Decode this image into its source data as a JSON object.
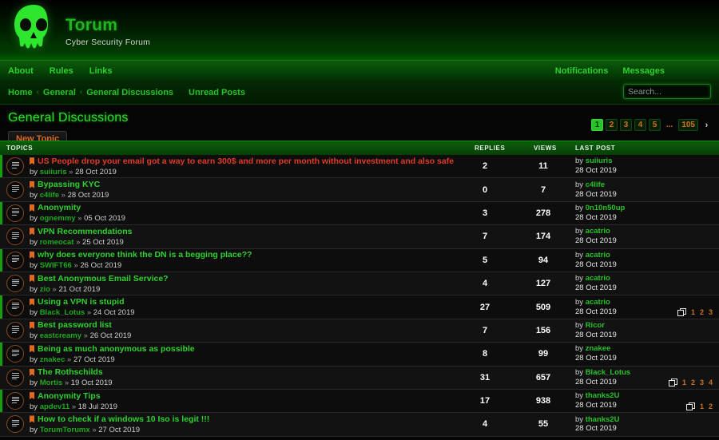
{
  "header": {
    "brand_title": "Torum",
    "brand_subtitle": "Cyber Security Forum",
    "logo_icon": "skull-icon"
  },
  "nav": {
    "left_links": [
      {
        "label": "About"
      },
      {
        "label": "Rules"
      },
      {
        "label": "Links"
      }
    ],
    "right_links": [
      {
        "label": "Notifications"
      },
      {
        "label": "Messages"
      }
    ]
  },
  "breadcrumb": {
    "items": [
      {
        "label": "Home"
      },
      {
        "label": "General"
      },
      {
        "label": "General Discussions"
      }
    ],
    "separator": "‹",
    "extra_link": "Unread Posts"
  },
  "search": {
    "placeholder": "Search...",
    "value": "",
    "icon": "search-icon"
  },
  "page": {
    "title": "General Discussions",
    "new_topic_label": "New Topic"
  },
  "pagination": {
    "pages": [
      "1",
      "2",
      "3",
      "4",
      "5",
      "...",
      "105"
    ],
    "active": "1",
    "next_label": "›"
  },
  "table": {
    "columns": {
      "topics": "TOPICS",
      "replies": "REPLIES",
      "views": "VIEWS",
      "lastpost": "LAST POST"
    },
    "by_label": "by",
    "meta_separator": "»"
  },
  "topics": [
    {
      "title": "US People drop your email got a way to earn 300$ and more per month without investment and also safe",
      "title_color": "red",
      "author": "suiiuris",
      "date": "28 Oct 2019",
      "replies": "2",
      "views": "11",
      "last_user": "suiiuris",
      "last_date": "28 Oct 2019",
      "subpages": []
    },
    {
      "title": "Bypassing KYC",
      "title_color": "green",
      "author": "c4life",
      "date": "28 Oct 2019",
      "replies": "0",
      "views": "7",
      "last_user": "c4life",
      "last_date": "28 Oct 2019",
      "subpages": []
    },
    {
      "title": "Anonymity",
      "title_color": "green",
      "author": "ognemmy",
      "date": "05 Oct 2019",
      "replies": "3",
      "views": "278",
      "last_user": "0n10n50up",
      "last_date": "28 Oct 2019",
      "subpages": []
    },
    {
      "title": "VPN Recommendations",
      "title_color": "green",
      "author": "romeocat",
      "date": "25 Oct 2019",
      "replies": "7",
      "views": "174",
      "last_user": "acatrio",
      "last_date": "28 Oct 2019",
      "subpages": []
    },
    {
      "title": "why does everyone think the DN is a begging place??",
      "title_color": "green",
      "author": "SWIFT66",
      "date": "26 Oct 2019",
      "replies": "5",
      "views": "94",
      "last_user": "acatrio",
      "last_date": "28 Oct 2019",
      "subpages": []
    },
    {
      "title": "Best Anonymous Email Service?",
      "title_color": "green",
      "author": "zio",
      "date": "21 Oct 2019",
      "replies": "4",
      "views": "127",
      "last_user": "acatrio",
      "last_date": "28 Oct 2019",
      "subpages": []
    },
    {
      "title": "Using a VPN is stupid",
      "title_color": "green",
      "author": "Black_Lotus",
      "date": "24 Oct 2019",
      "replies": "27",
      "views": "509",
      "last_user": "acatrio",
      "last_date": "28 Oct 2019",
      "subpages": [
        "1",
        "2",
        "3"
      ]
    },
    {
      "title": "Best password list",
      "title_color": "green",
      "author": "eastcreamy",
      "date": "26 Oct 2019",
      "replies": "7",
      "views": "156",
      "last_user": "Ricor",
      "last_date": "28 Oct 2019",
      "subpages": []
    },
    {
      "title": "Being as much anonymous as possible",
      "title_color": "green",
      "author": "znakec",
      "date": "27 Oct 2019",
      "replies": "8",
      "views": "99",
      "last_user": "znakee",
      "last_date": "28 Oct 2019",
      "subpages": []
    },
    {
      "title": "The Rothschilds",
      "title_color": "green",
      "author": "Mortis",
      "date": "19 Oct 2019",
      "replies": "31",
      "views": "657",
      "last_user": "Black_Lotus",
      "last_date": "28 Oct 2019",
      "subpages": [
        "1",
        "2",
        "3",
        "4"
      ]
    },
    {
      "title": "Anonymity Tips",
      "title_color": "green",
      "author": "apdev11",
      "date": "18 Jul 2019",
      "replies": "17",
      "views": "938",
      "last_user": "thanks2U",
      "last_date": "28 Oct 2019",
      "subpages": [
        "1",
        "2"
      ]
    },
    {
      "title": "How to check if a windows 10 Iso is legit !!!",
      "title_color": "green",
      "author": "TorumTorumx",
      "date": "27 Oct 2019",
      "replies": "4",
      "views": "55",
      "last_user": "thanks2U",
      "last_date": "28 Oct 2019",
      "subpages": []
    }
  ],
  "colors": {
    "accent_green": "#2fd12f",
    "brand_green": "#22b422",
    "orange": "#e06a1f",
    "red_title": "#e03b2a",
    "background": "#0d0d0d"
  }
}
